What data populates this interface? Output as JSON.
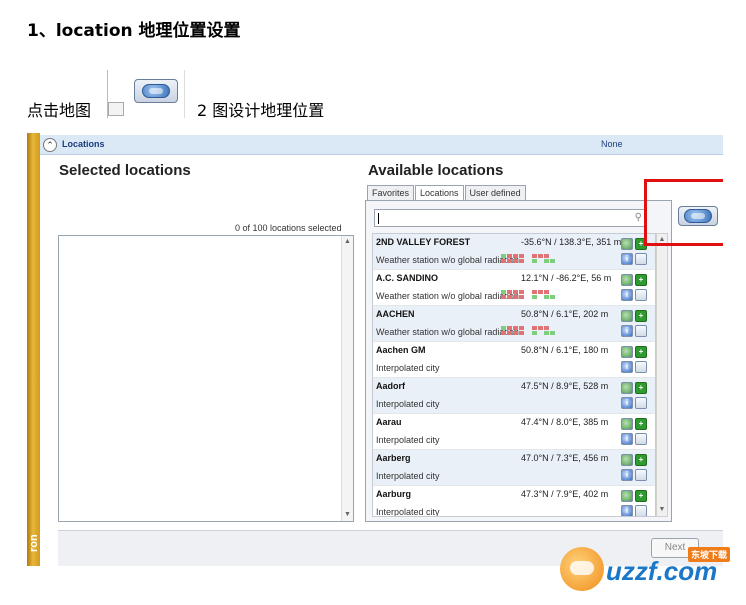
{
  "doc": {
    "heading": "1、location 地理位置设置",
    "instruction_left": "点击地图",
    "instruction_right": "2 图设计地理位置"
  },
  "app": {
    "section_title": "Locations",
    "section_value": "None",
    "selected_title": "Selected locations",
    "selected_count": "0 of 100 locations selected",
    "available_title": "Available locations",
    "tabs": [
      "Favorites",
      "Locations",
      "User defined"
    ],
    "active_tab": "Locations",
    "search_value": "",
    "next_label": "Next",
    "strip_text": "ron",
    "locations": [
      {
        "name": "2ND VALLEY FOREST",
        "coord": "-35.6°N / 138.3°E, 351 m",
        "type": "Weather station w/o global radiation",
        "quality": true
      },
      {
        "name": "A.C. SANDINO",
        "coord": "12.1°N / -86.2°E, 56 m",
        "type": "Weather station w/o global radiation",
        "quality": true
      },
      {
        "name": "AACHEN",
        "coord": "50.8°N / 6.1°E, 202 m",
        "type": "Weather station w/o global radiation",
        "quality": true
      },
      {
        "name": "Aachen GM",
        "coord": "50.8°N / 6.1°E, 180 m",
        "type": "Interpolated city",
        "quality": false
      },
      {
        "name": "Aadorf",
        "coord": "47.5°N / 8.9°E, 528 m",
        "type": "Interpolated city",
        "quality": false
      },
      {
        "name": "Aarau",
        "coord": "47.4°N / 8.0°E, 385 m",
        "type": "Interpolated city",
        "quality": false
      },
      {
        "name": "Aarberg",
        "coord": "47.0°N / 7.3°E, 456 m",
        "type": "Interpolated city",
        "quality": false
      },
      {
        "name": "Aarburg",
        "coord": "47.3°N / 7.9°E, 402 m",
        "type": "Interpolated city",
        "quality": false
      }
    ]
  },
  "watermark": {
    "text": "uzzf.com",
    "tag": "东坡下载"
  },
  "colors": {
    "highlight": "#e01010",
    "header": "#dbe9f7",
    "title_blue": "#1a3d7a"
  }
}
